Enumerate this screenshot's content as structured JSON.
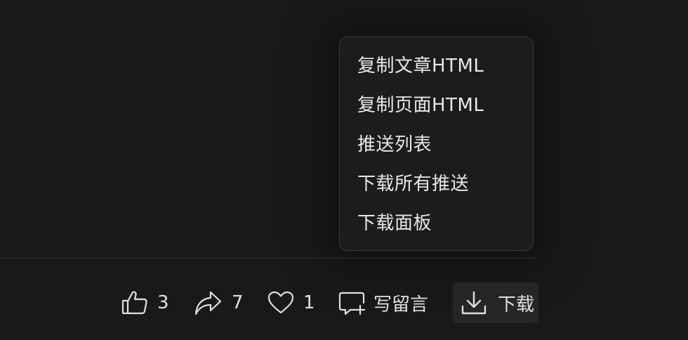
{
  "menu": {
    "items": [
      {
        "label": "复制文章HTML"
      },
      {
        "label": "复制页面HTML"
      },
      {
        "label": "推送列表"
      },
      {
        "label": "下载所有推送"
      },
      {
        "label": "下载面板"
      }
    ]
  },
  "actions": {
    "like": {
      "icon": "thumbs-up-icon",
      "count": "3"
    },
    "share": {
      "icon": "share-arrow-icon",
      "count": "7"
    },
    "favorite": {
      "icon": "heart-icon",
      "count": "1"
    },
    "comment": {
      "icon": "comment-add-icon",
      "label": "写留言"
    },
    "download": {
      "icon": "download-icon",
      "label": "下载"
    }
  }
}
